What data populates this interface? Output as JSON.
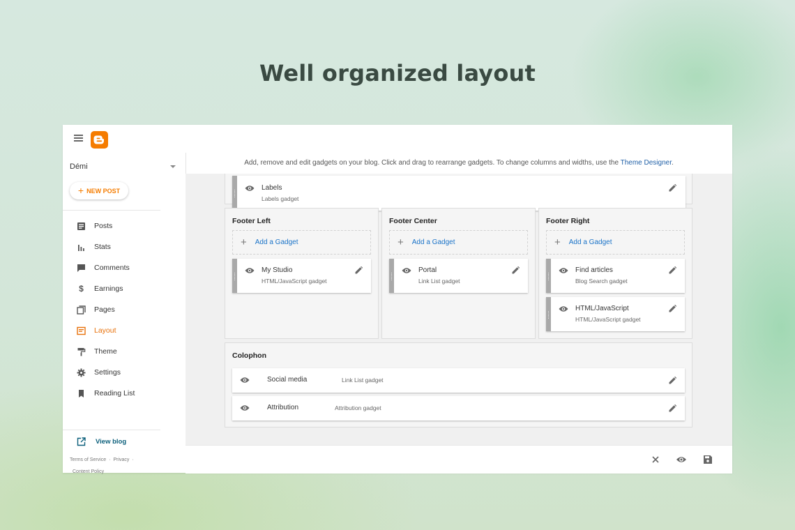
{
  "headline": "Well organized layout",
  "app": {
    "blog_name": "Démi",
    "new_post_label": "NEW POST",
    "nav": [
      {
        "label": "Posts",
        "icon": "posts-icon"
      },
      {
        "label": "Stats",
        "icon": "stats-icon"
      },
      {
        "label": "Comments",
        "icon": "comments-icon"
      },
      {
        "label": "Earnings",
        "icon": "dollar-icon"
      },
      {
        "label": "Pages",
        "icon": "pages-icon"
      },
      {
        "label": "Layout",
        "icon": "layout-icon",
        "active": true
      },
      {
        "label": "Theme",
        "icon": "paint-roller-icon"
      },
      {
        "label": "Settings",
        "icon": "gear-icon"
      },
      {
        "label": "Reading List",
        "icon": "bookmark-icon"
      }
    ],
    "view_blog_label": "View blog",
    "footer_links": {
      "terms": "Terms of Service",
      "privacy": "Privacy",
      "content_policy": "Content Policy"
    },
    "accent_color": "#e8710a"
  },
  "info_bar": {
    "text": "Add, remove and edit gadgets on your blog. Click and drag to rearrange gadgets. To change columns and widths, use the ",
    "link": "Theme Designer",
    "suffix": "."
  },
  "layout": {
    "top_gadget": {
      "name": "Labels",
      "type": "Labels gadget"
    },
    "add_gadget_label": "Add a Gadget",
    "footer_left": {
      "title": "Footer Left",
      "gadgets": [
        {
          "name": "My Studio",
          "type": "HTML/JavaScript gadget"
        }
      ]
    },
    "footer_center": {
      "title": "Footer Center",
      "gadgets": [
        {
          "name": "Portal",
          "type": "Link List gadget"
        }
      ]
    },
    "footer_right": {
      "title": "Footer Right",
      "gadgets": [
        {
          "name": "Find articles",
          "type": "Blog Search gadget"
        },
        {
          "name": "HTML/JavaScript",
          "type": "HTML/JavaScript gadget"
        }
      ]
    },
    "colophon": {
      "title": "Colophon",
      "gadgets": [
        {
          "name": "Social media",
          "type": "Link List gadget"
        },
        {
          "name": "Attribution",
          "type": "Attribution gadget"
        }
      ]
    }
  },
  "bottom_bar": {
    "icons": [
      "close-icon",
      "preview-eye-icon",
      "save-icon"
    ]
  }
}
